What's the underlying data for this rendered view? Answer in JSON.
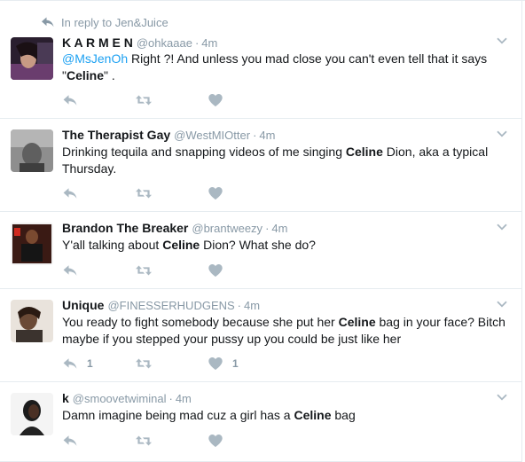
{
  "reply_context": {
    "label": "In reply to Jen&Juice"
  },
  "colors": {
    "icon": "#aab8c2",
    "muted": "#8899a6",
    "link": "#1da1f2",
    "text": "#14171a",
    "divider": "#e6ecf0"
  },
  "icons": {
    "reply": "reply-arrow",
    "retweet": "retweet-arrows",
    "like": "heart",
    "menu": "chevron-down"
  },
  "tweets": [
    {
      "name": "K A R M E N",
      "handle": "@ohkaaae",
      "time": "4m",
      "mention": "@MsJenOh",
      "text_a": " Right ?! And unless you mad close you can't even tell that it says \"",
      "highlight": "Celine",
      "text_b": "\"  .",
      "reply_count": "",
      "like_count": ""
    },
    {
      "name": "The Therapist Gay",
      "handle": "@WestMIOtter",
      "time": "4m",
      "text_a": "Drinking tequila and snapping videos of me singing ",
      "highlight": "Celine",
      "text_b": " Dion, aka a typical Thursday.",
      "reply_count": "",
      "like_count": ""
    },
    {
      "name": "Brandon The Breaker",
      "handle": "@brantweezy",
      "time": "4m",
      "text_a": "Y'all talking about ",
      "highlight": "Celine",
      "text_b": " Dion? What she do?",
      "reply_count": "",
      "like_count": ""
    },
    {
      "name": "Unique",
      "handle": "@FINESSERHUDGENS",
      "time": "4m",
      "text_a": "You ready to fight somebody because she put her ",
      "highlight": "Celine",
      "text_b": " bag in your face? Bitch maybe if you stepped your pussy up you could be just like her",
      "reply_count": "1",
      "like_count": "1"
    },
    {
      "name": "k",
      "handle": "@smoovetwiminal",
      "time": "4m",
      "text_a": "Damn imagine being mad cuz a girl has a ",
      "highlight": "Celine",
      "text_b": " bag",
      "reply_count": "",
      "like_count": ""
    }
  ]
}
